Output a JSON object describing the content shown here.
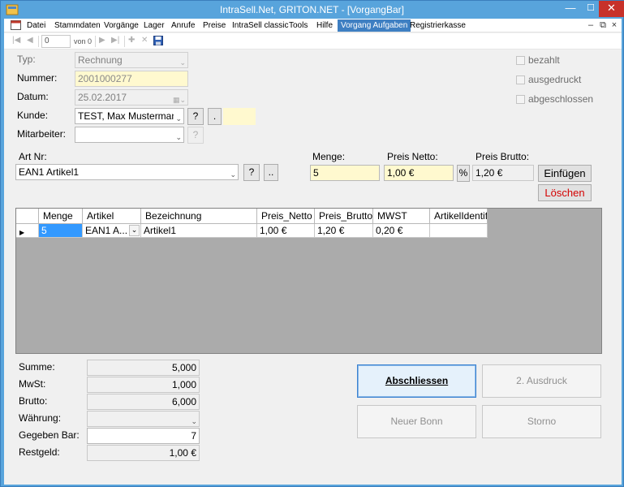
{
  "window": {
    "title": "IntraSell.Net, GRITON.NET - [VorgangBar]",
    "min_glyph": "—",
    "max_glyph": "☐",
    "close_glyph": "✕"
  },
  "menu": {
    "items": [
      "Datei",
      "Stammdaten",
      "Vorgänge",
      "Lager",
      "Anrufe",
      "Preise",
      "IntraSell classic",
      "Tools",
      "Hilfe",
      "Vorgang Aufgaben",
      "Registrierkasse"
    ],
    "active_index": 9,
    "mdi_min": "–",
    "mdi_restore": "⧉",
    "mdi_close": "×"
  },
  "navigator": {
    "first": "|◀",
    "prev": "◀",
    "position": "0",
    "count": "von 0",
    "next": "▶",
    "last": "▶|",
    "add": "✚",
    "delete": "✕",
    "save": "💾"
  },
  "form": {
    "typ": {
      "label": "Typ:",
      "value": "Rechnung"
    },
    "nummer": {
      "label": "Nummer:",
      "value": "2001000277"
    },
    "datum": {
      "label": "Datum:",
      "value": "25.02.2017"
    },
    "kunde": {
      "label": "Kunde:",
      "value": "TEST, Max Mustermann",
      "help": "?",
      "more": "."
    },
    "mitarbeiter": {
      "label": "Mitarbeiter:",
      "value": "",
      "help": "?"
    },
    "checkboxes": [
      {
        "label": "bezahlt",
        "checked": false
      },
      {
        "label": "ausgedruckt",
        "checked": false
      },
      {
        "label": "abgeschlossen",
        "checked": false
      }
    ]
  },
  "article_entry": {
    "art_nr_label": "Art Nr:",
    "art_nr_value": "EAN1 Artikel1",
    "help": "?",
    "more": "..",
    "menge_label": "Menge:",
    "menge_value": "5",
    "netto_label": "Preis Netto:",
    "netto_value": "1,00 €",
    "percent": "%",
    "brutto_label": "Preis Brutto:",
    "brutto_value": "1,20 €",
    "einfuegen": "Einfügen",
    "loeschen": "Löschen"
  },
  "grid": {
    "columns": [
      "Menge",
      "Artikel",
      "Bezeichnung",
      "Preis_Netto",
      "Preis_Brutto",
      "MWST",
      "ArtikelIdentif"
    ],
    "rows": [
      {
        "indicator": "▶",
        "menge": "5",
        "artikel": "EAN1 A...",
        "bezeichnung": "Artikel1",
        "preis_netto": "1,00 €",
        "preis_brutto": "1,20 €",
        "mwst": "0,20 €",
        "artikel_identif": ""
      }
    ]
  },
  "summary": {
    "summe": {
      "label": "Summe:",
      "value": "5,000"
    },
    "mwst": {
      "label": "MwSt:",
      "value": "1,000"
    },
    "brutto": {
      "label": "Brutto:",
      "value": "6,000"
    },
    "waehrung": {
      "label": "Währung:",
      "value": ""
    },
    "gegeben": {
      "label": "Gegeben Bar:",
      "value": "7"
    },
    "restgeld": {
      "label": "Restgeld:",
      "value": "1,00 €"
    }
  },
  "actions": {
    "abschliessen": "Abschliessen",
    "ausdruck2": "2. Ausdruck",
    "neuer_bonn": "Neuer Bonn",
    "storno": "Storno"
  }
}
